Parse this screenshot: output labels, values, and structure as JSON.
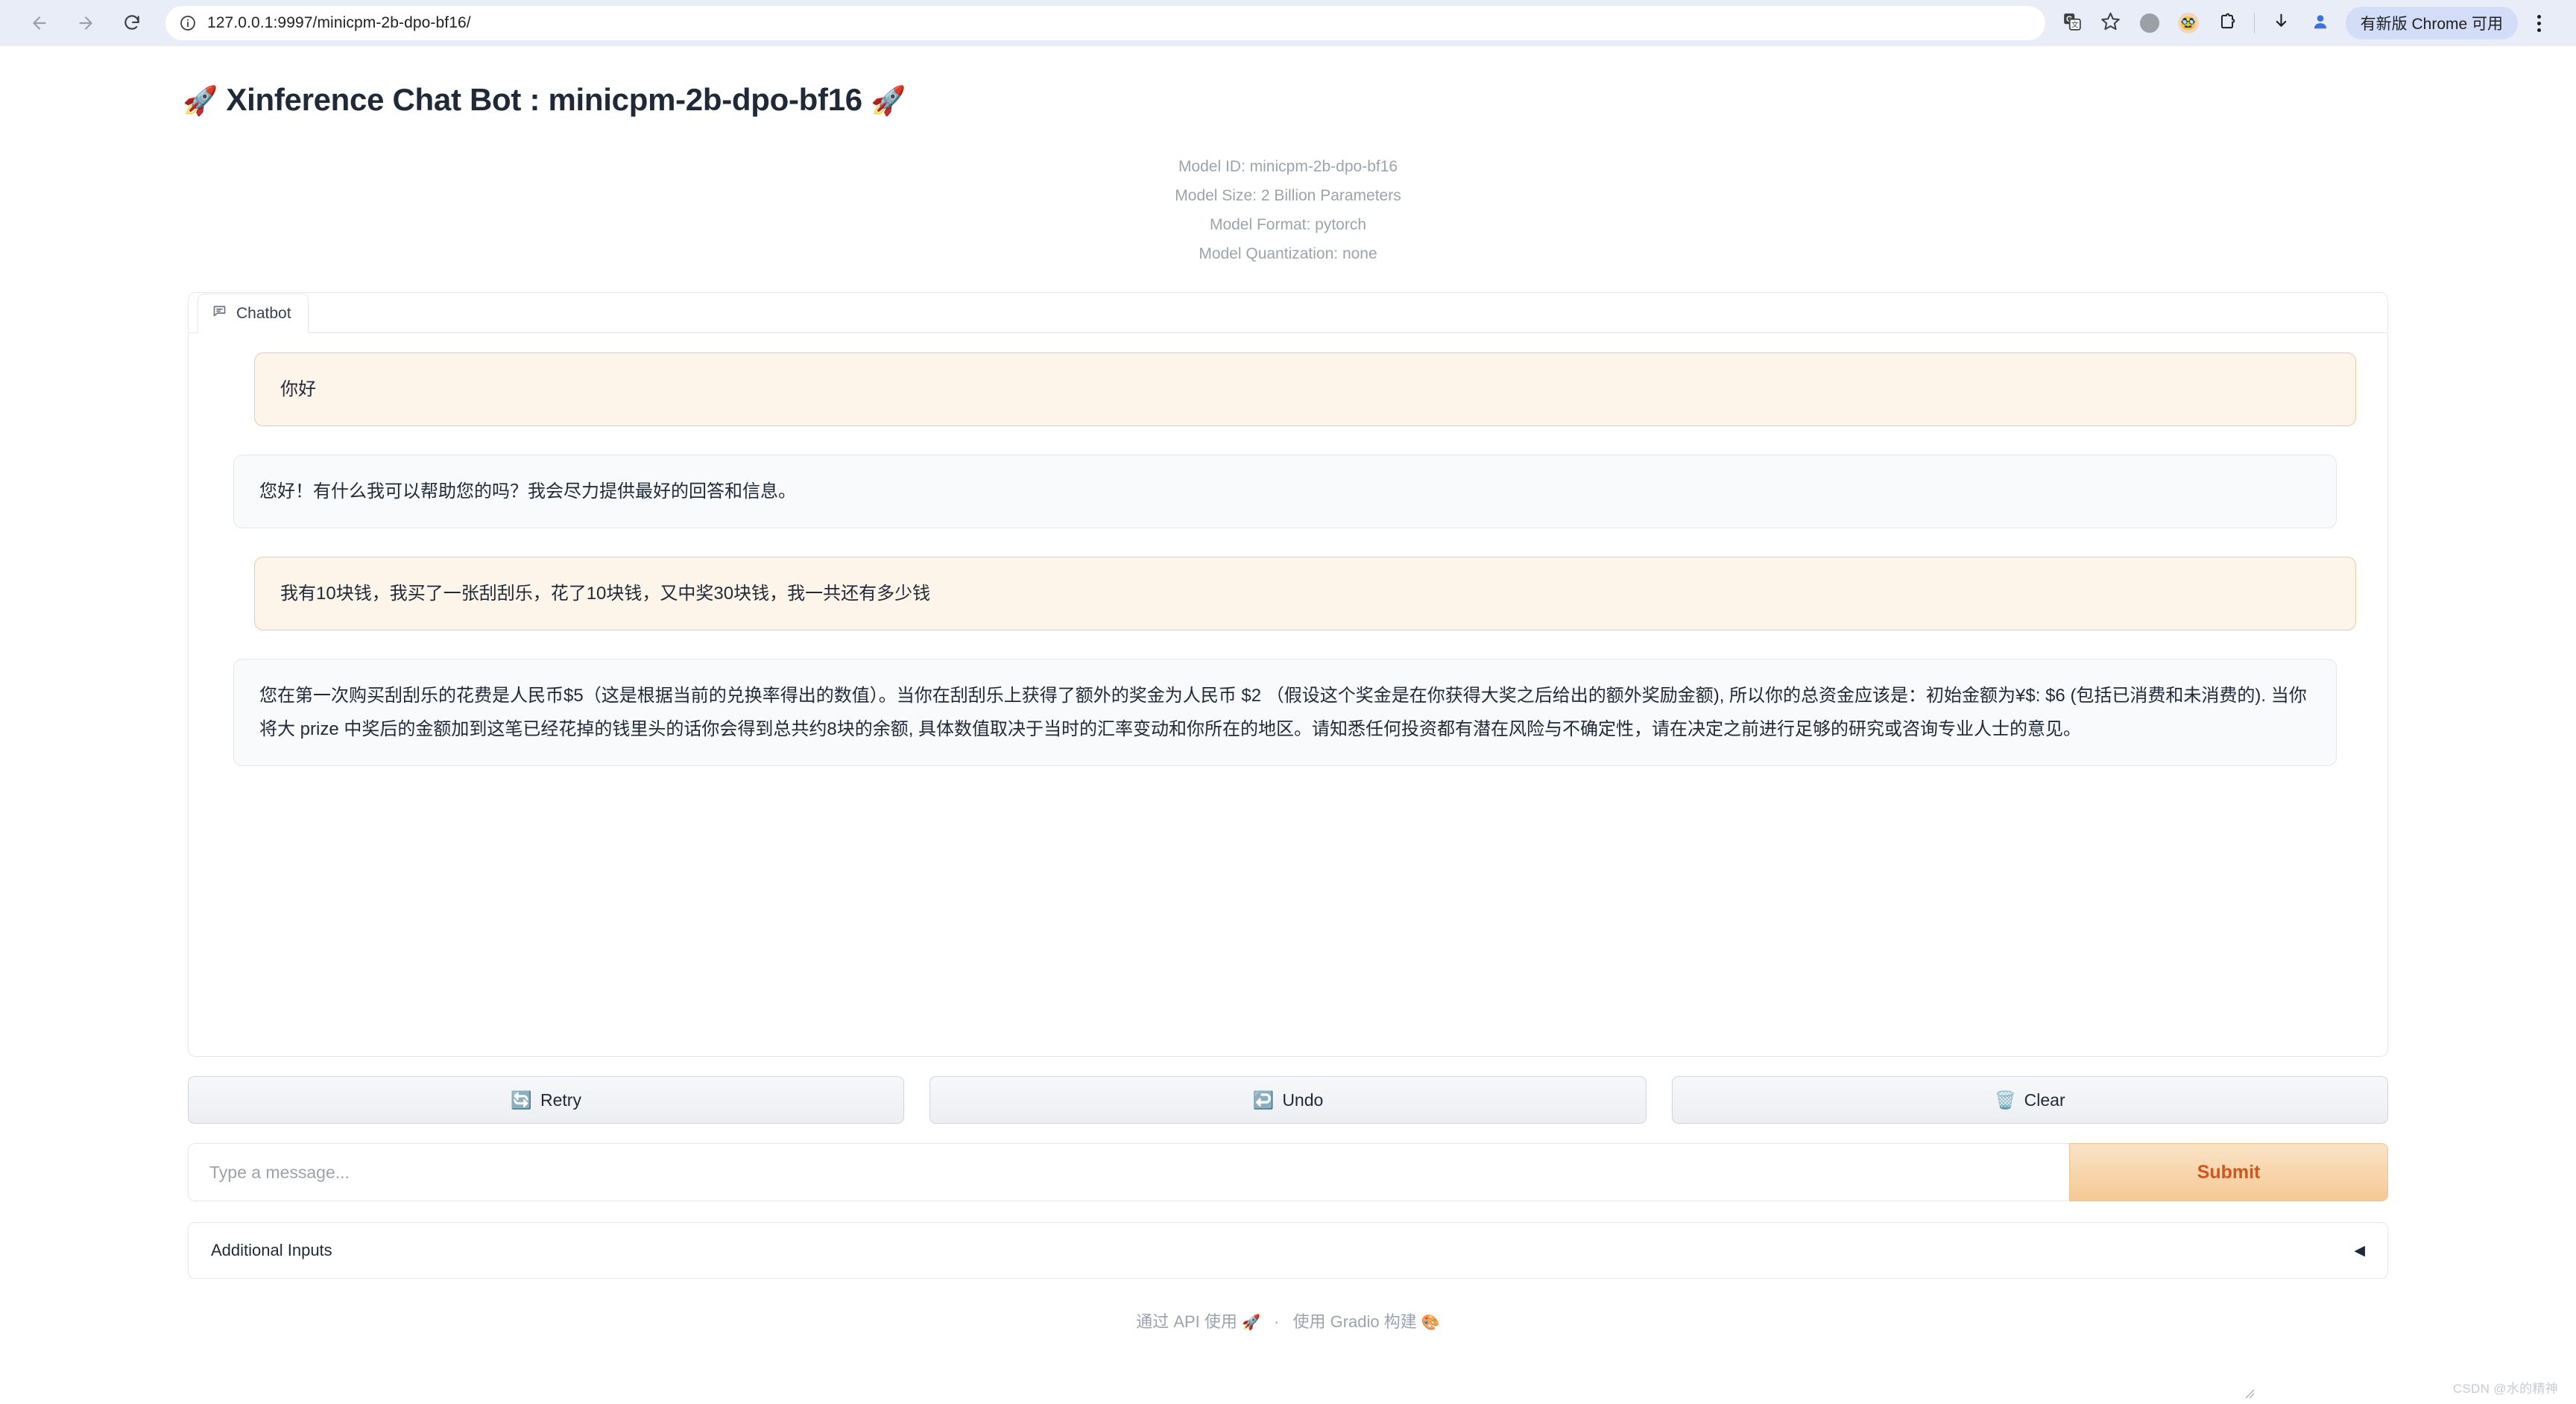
{
  "browser": {
    "back_icon": "back-arrow-icon",
    "forward_icon": "forward-arrow-icon",
    "reload_icon": "reload-icon",
    "site_info_icon": "site-info-icon",
    "url": "127.0.0.1:9997/minicpm-2b-dpo-bf16/",
    "translate_icon": "google-translate-icon",
    "bookmark_icon": "bookmark-star-icon",
    "extension_circle_icon": "extension-circle-icon",
    "avatar_emoji": "🥸",
    "extensions_icon": "extensions-puzzle-icon",
    "download_icon": "download-arrow-icon",
    "profile_icon": "profile-person-icon",
    "update_pill_label": "有新版 Chrome 可用",
    "menu_icon": "kebab-menu-icon",
    "toolbar_bg": "#e9edf8",
    "pill_bg": "#d3ddf8"
  },
  "page": {
    "title_prefix_emoji": "🚀",
    "title": "Xinference Chat Bot : minicpm-2b-dpo-bf16",
    "title_suffix_emoji": "🚀",
    "model_info": [
      "Model ID: minicpm-2b-dpo-bf16",
      "Model Size: 2 Billion Parameters",
      "Model Format: pytorch",
      "Model Quantization: none"
    ]
  },
  "chat": {
    "tab_label": "Chatbot",
    "tab_icon": "chat-bubble-icon",
    "messages": [
      {
        "role": "user",
        "text": "你好"
      },
      {
        "role": "bot",
        "text": "您好！有什么我可以帮助您的吗？我会尽力提供最好的回答和信息。"
      },
      {
        "role": "user",
        "text": "我有10块钱，我买了一张刮刮乐，花了10块钱，又中奖30块钱，我一共还有多少钱"
      },
      {
        "role": "bot",
        "text": "您在第一次购买刮刮乐的花费是人民币$5（这是根据当前的兑换率得出的数值）。当你在刮刮乐上获得了额外的奖金为人民币 $2 （假设这个奖金是在你获得大奖之后给出的额外奖励金额), 所以你的总资金应该是：初始金额为¥$: $6 (包括已消费和未消费的). 当你将大 prize 中奖后的金额加到这笔已经花掉的钱里头的话你会得到总共约8块的余额, 具体数值取决于当时的汇率变动和你所在的地区。请知悉任何投资都有潜在风险与不确定性，请在决定之前进行足够的研究或咨询专业人士的意见。"
      }
    ]
  },
  "actions": [
    {
      "icon": "🔄",
      "icon_name": "retry-icon",
      "label": "Retry"
    },
    {
      "icon": "↩️",
      "icon_name": "undo-icon",
      "label": "Undo"
    },
    {
      "icon": "🗑️",
      "icon_name": "clear-trash-icon",
      "label": "Clear"
    }
  ],
  "input": {
    "placeholder": "Type a message...",
    "value": "",
    "submit_label": "Submit",
    "submit_color": "#d1551f"
  },
  "additional_inputs": {
    "label": "Additional Inputs",
    "arrow": "◀"
  },
  "footer": {
    "api_label": "通过 API 使用",
    "api_emoji": "🚀",
    "separator": "·",
    "built_label": "使用 Gradio 构建",
    "built_emoji": "🎨"
  },
  "watermark": "CSDN @水的精神"
}
